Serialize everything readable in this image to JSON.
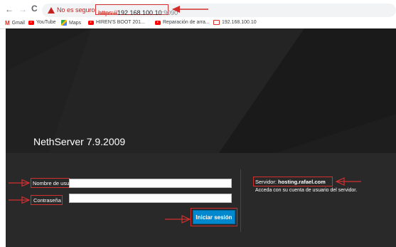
{
  "browser": {
    "not_secure": "No es seguro",
    "url_protocol": "https://",
    "url_host": "192.168.100.10",
    "url_port": ":9090",
    "bookmarks": [
      {
        "label": "Gmail",
        "icon": "gmail-icon"
      },
      {
        "label": "YouTube",
        "icon": "youtube-icon"
      },
      {
        "label": "Maps",
        "icon": "maps-icon"
      },
      {
        "label": "HIREN'S BOOT 201...",
        "icon": "youtube-icon"
      },
      {
        "label": "Reparación de arra...",
        "icon": "youtube-icon"
      },
      {
        "label": "192.168.100.10",
        "icon": "monitor-icon"
      }
    ]
  },
  "login": {
    "brand": "NethServer 7.9.2009",
    "username_label": "Nombre de usuario",
    "password_label": "Contraseña",
    "submit_label": "Iniciar sesión",
    "server_prefix": "Servidor: ",
    "server_name": "hosting.rafael.com",
    "server_help": "Acceda con su cuenta de usuario del servidor."
  },
  "colors": {
    "annotation": "#d32f2f",
    "button": "#0088ce",
    "background": "#1e1e1e"
  }
}
